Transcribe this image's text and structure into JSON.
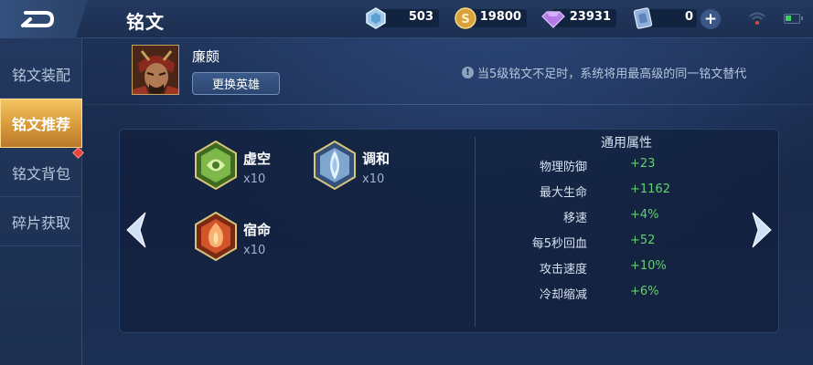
{
  "header": {
    "title": "铭文",
    "currencies": [
      {
        "name": "diamond-coupon",
        "value": "503"
      },
      {
        "name": "gold-coin",
        "value": "19800"
      },
      {
        "name": "diamond",
        "value": "23931"
      },
      {
        "name": "voucher",
        "value": "0"
      }
    ],
    "add_symbol": "+"
  },
  "sidebar": {
    "items": [
      {
        "label": "铭文装配",
        "active": false
      },
      {
        "label": "铭文推荐",
        "active": true
      },
      {
        "label": "铭文背包",
        "active": false
      },
      {
        "label": "碎片获取",
        "active": false
      }
    ]
  },
  "hero": {
    "name": "廉颇",
    "change_button": "更换英雄"
  },
  "notice": {
    "icon": "!",
    "text": "当5级铭文不足时，系统将用最高级的同一铭文替代"
  },
  "runes": [
    {
      "name": "虚空",
      "count": "x10",
      "color": "#7fb84a"
    },
    {
      "name": "调和",
      "count": "x10",
      "color": "#9fc4e6"
    },
    {
      "name": "宿命",
      "count": "x10",
      "color": "#e2642e"
    }
  ],
  "stats": {
    "title": "通用属性",
    "rows": [
      {
        "name": "物理防御",
        "value": "+23"
      },
      {
        "name": "最大生命",
        "value": "+1162"
      },
      {
        "name": "移速",
        "value": "+4%"
      },
      {
        "name": "每5秒回血",
        "value": "+52"
      },
      {
        "name": "攻击速度",
        "value": "+10%"
      },
      {
        "name": "冷却缩减",
        "value": "+6%"
      }
    ]
  },
  "colors": {
    "accent_gold": "#e0a84a",
    "stat_green": "#63d16f",
    "background": "#1a2c4e"
  }
}
